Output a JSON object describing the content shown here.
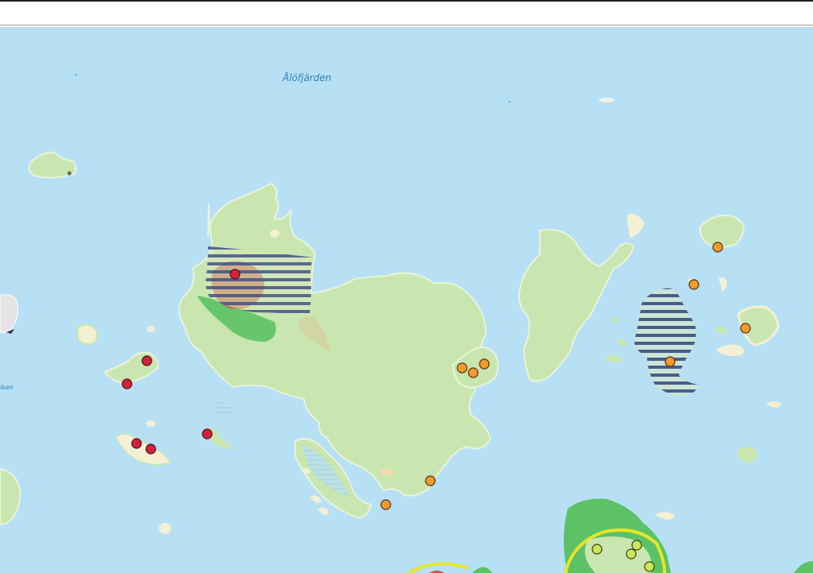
{
  "map": {
    "labels": {
      "bay": "Ålöfjärden",
      "edge_place": "iken",
      "quote_marks": "\""
    },
    "colors": {
      "water": "#b7e0f5",
      "land": "#c9e6b0",
      "land_dark": "#5cc265",
      "sand": "#f4f0d4",
      "hatch": "#4a5a8f",
      "red_zone": "#c24a4a",
      "yellow_outline": "#e6e62a"
    },
    "markers": {
      "red": 7,
      "orange": 10,
      "yellow_green": 5
    },
    "icons": [
      "cross-icon",
      "fish-icon"
    ]
  }
}
